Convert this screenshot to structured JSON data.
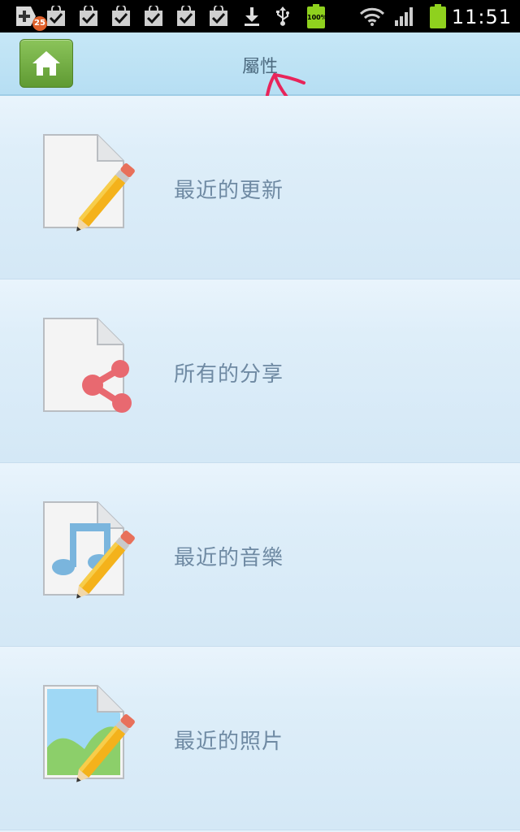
{
  "status_bar": {
    "notification_badge": "25",
    "battery_label": "100%",
    "time": "11:51",
    "icons": [
      "add-notification-icon",
      "bag-check-icon",
      "bag-check-icon",
      "bag-check-icon",
      "bag-check-icon",
      "bag-check-icon",
      "bag-check-icon",
      "download-icon",
      "usb-icon",
      "battery-full-icon",
      "wifi-icon",
      "signal-icon",
      "battery-icon"
    ],
    "battery_color": "#8fd11e"
  },
  "header": {
    "title": "屬性",
    "home_icon": "home-icon",
    "home_button_color": "#6aa83b"
  },
  "annotation": {
    "color": "#e8245a",
    "icon": "red-arrow-annotation"
  },
  "menu": {
    "items": [
      {
        "label": "最近的更新",
        "icon": "document-pencil-icon"
      },
      {
        "label": "所有的分享",
        "icon": "document-share-icon"
      },
      {
        "label": "最近的音樂",
        "icon": "music-document-pencil-icon"
      },
      {
        "label": "最近的照片",
        "icon": "photo-document-pencil-icon"
      }
    ]
  }
}
